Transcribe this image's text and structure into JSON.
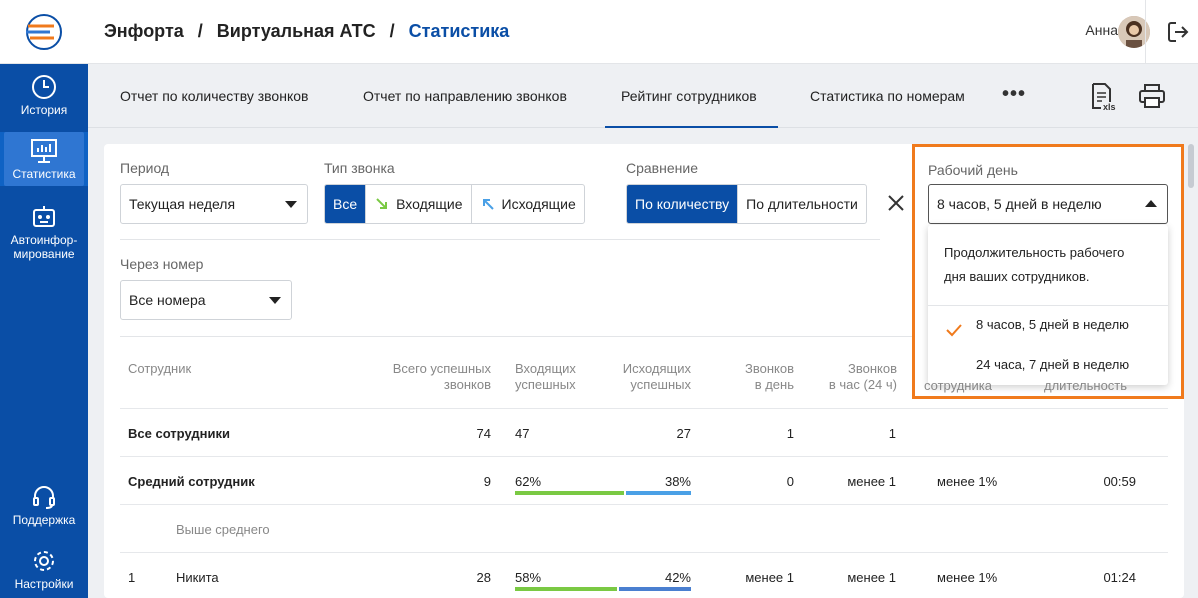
{
  "sidebar": {
    "items": [
      {
        "label": "История",
        "icon": "clock-icon"
      },
      {
        "label": "Статистика",
        "icon": "monitor-chart-icon"
      },
      {
        "label": "Автоинфор-мирование",
        "icon": "robot-icon"
      },
      {
        "label": "Поддержка",
        "icon": "headset-icon"
      },
      {
        "label": "Настройки",
        "icon": "gear-icon"
      }
    ]
  },
  "header": {
    "crumb1": "Энфорта",
    "crumb2": "Виртуальная АТС",
    "crumb3": "Статистика",
    "sep": "/",
    "user": "Анна"
  },
  "tabs": {
    "t1": "Отчет по количеству звонков",
    "t2": "Отчет по направлению звонков",
    "t3": "Рейтинг сотрудников",
    "t4": "Статистика по номерам",
    "more": "•••"
  },
  "filters": {
    "period_label": "Период",
    "period_value": "Текущая неделя",
    "type_label": "Тип звонка",
    "type_all": "Все",
    "type_in": "Входящие",
    "type_out": "Исходящие",
    "cmp_label": "Сравнение",
    "cmp_count": "По количеству",
    "cmp_dur": "По длительности",
    "via_label": "Через номер",
    "via_value": "Все номера",
    "workday_label": "Рабочий день",
    "workday_value": "8 часов, 5 дней в неделю"
  },
  "dropdown": {
    "info_line1": "Продолжительность рабочего",
    "info_line2": "дня ваших сотрудников.",
    "opt1": "8 часов, 5 дней в неделю",
    "opt2": "24 часа, 7 дней в неделю"
  },
  "table": {
    "h_emp": "Сотрудник",
    "h_total1": "Всего успешных",
    "h_total2": "звонков",
    "h_in1": "Входящих",
    "h_in2": "успешных",
    "h_out1": "Исходящих",
    "h_out2": "успешных",
    "h_day1": "Звонков",
    "h_day2": "в день",
    "h_hour1": "Звонков",
    "h_hour2": "в час (24 ч)",
    "h_load": "сотрудника",
    "h_dur": "длительность",
    "rows": [
      {
        "num": "",
        "name": "Все сотрудники",
        "total": "74",
        "in": "47",
        "out": "27",
        "day": "1",
        "hour": "1",
        "load": "",
        "dur": ""
      },
      {
        "num": "",
        "name": "Средний сотрудник",
        "total": "9",
        "in": "62%",
        "out": "38%",
        "day": "0",
        "hour": "менее 1",
        "load": "менее 1%",
        "dur": "00:59",
        "in_frac": 0.62
      },
      {
        "num": "",
        "name": "Выше среднего"
      },
      {
        "num": "1",
        "name": "Никита",
        "total": "28",
        "in": "58%",
        "out": "42%",
        "day": "менее 1",
        "hour": "менее 1",
        "load": "менее 1%",
        "dur": "01:24",
        "in_frac": 0.58
      }
    ]
  },
  "colors": {
    "primary": "#0a4ea6",
    "accent": "#f07a1c",
    "in_bar": "#7ac943",
    "out_bar": "#4aa0e6"
  }
}
